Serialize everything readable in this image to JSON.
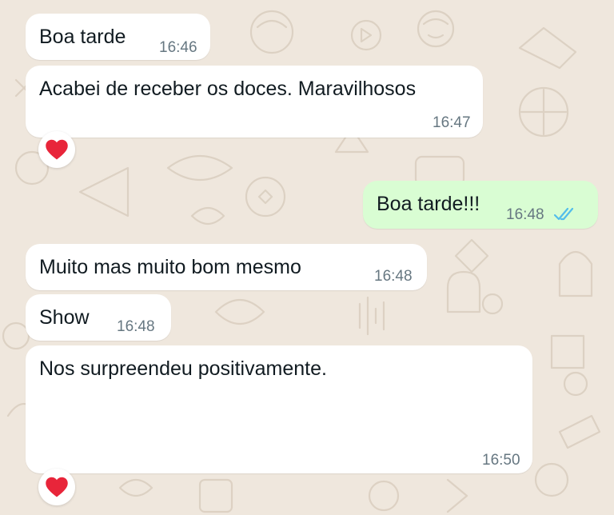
{
  "colors": {
    "background": "#efe7dd",
    "incoming_bubble": "#ffffff",
    "outgoing_bubble": "#d9fdd3",
    "timestamp": "#667781",
    "read_ticks": "#53bdeb",
    "reaction_heart": "#e8253a"
  },
  "messages": [
    {
      "direction": "incoming",
      "text": "Boa tarde",
      "time": "16:46"
    },
    {
      "direction": "incoming",
      "text": "Acabei de receber os doces. Maravilhosos",
      "time": "16:47",
      "reaction": "red-heart"
    },
    {
      "direction": "outgoing",
      "text": "Boa tarde!!!",
      "time": "16:48",
      "status": "read"
    },
    {
      "direction": "incoming",
      "text": "Muito mas muito bom mesmo",
      "time": "16:48"
    },
    {
      "direction": "incoming",
      "text": "Show",
      "time": "16:48"
    },
    {
      "direction": "incoming",
      "text": "Nos surpreendeu positivamente.",
      "time": "16:50",
      "reaction": "red-heart"
    }
  ]
}
